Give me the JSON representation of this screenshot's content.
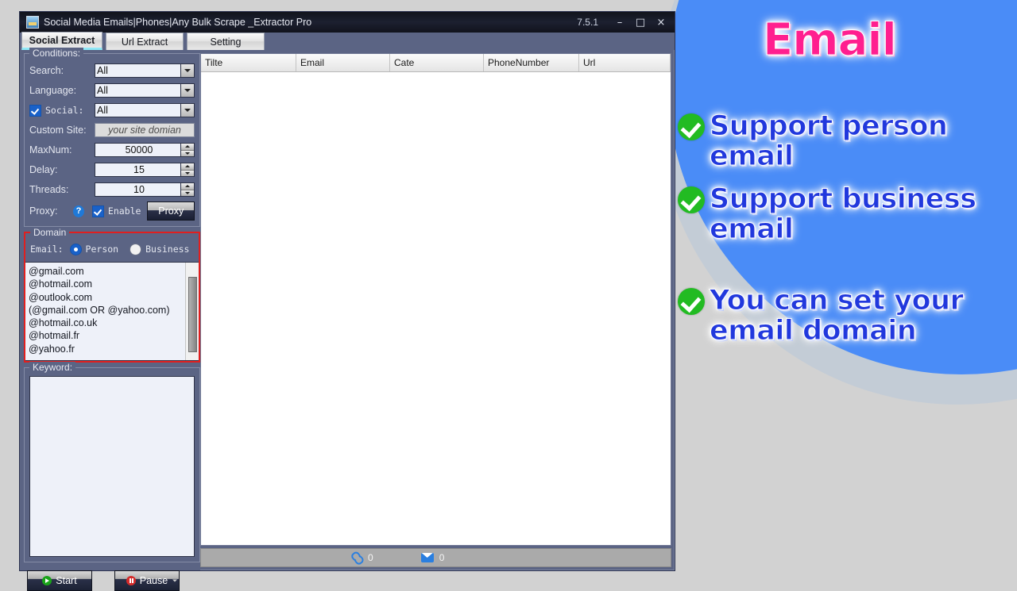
{
  "window": {
    "title": "Social Media Emails|Phones|Any Bulk Scrape _Extractor Pro",
    "version": "7.5.1",
    "icon": "app-icon",
    "controls": {
      "minimize": "–",
      "maximize": "□",
      "close": "×"
    }
  },
  "tabs": [
    {
      "label": "Social Extract",
      "active": true
    },
    {
      "label": "Url Extract",
      "active": false
    },
    {
      "label": "Setting",
      "active": false
    }
  ],
  "conditions": {
    "legend": "Conditions:",
    "search": {
      "label": "Search:",
      "value": "All"
    },
    "language": {
      "label": "Language:",
      "value": "All"
    },
    "social": {
      "label": "Social:",
      "value": "All",
      "checked": true
    },
    "custom_site": {
      "label": "Custom Site:",
      "placeholder": "your site domian",
      "value": ""
    },
    "maxnum": {
      "label": "MaxNum:",
      "value": "50000"
    },
    "delay": {
      "label": "Delay:",
      "value": "15"
    },
    "threads": {
      "label": "Threads:",
      "value": "10"
    },
    "proxy": {
      "label": "Proxy:",
      "help": "?",
      "enable_label": "Enable",
      "enable_checked": true,
      "button_label": "Proxy"
    }
  },
  "domain": {
    "legend": "Domain",
    "email_label": "Email:",
    "person_label": "Person",
    "business_label": "Business",
    "selected": "Person",
    "items": [
      "@gmail.com",
      "@hotmail.com",
      "@outlook.com",
      "(@gmail.com OR @yahoo.com)",
      "@hotmail.co.uk",
      "@hotmail.fr",
      "@yahoo.fr"
    ]
  },
  "keyword": {
    "legend": "Keyword:",
    "value": ""
  },
  "actions": {
    "start_label": "Start",
    "pause_label": "Pause"
  },
  "results": {
    "columns": [
      "Tilte",
      "Email",
      "Cate",
      "PhoneNumber",
      "Url"
    ],
    "rows": []
  },
  "statusbar": {
    "link_count": "0",
    "mail_count": "0"
  },
  "promo": {
    "title": "Email",
    "bullets": [
      "Support person email",
      "Support business\nemail",
      "You can set your\nemail domain"
    ]
  },
  "colors": {
    "accent_blue": "#4a8cf7",
    "promo_title_pink": "#ff1f8f",
    "promo_text_blue": "#2138dd",
    "check_green": "#22bb22",
    "highlight_red": "#e01f1f",
    "window_chrome": "#5b6484"
  }
}
